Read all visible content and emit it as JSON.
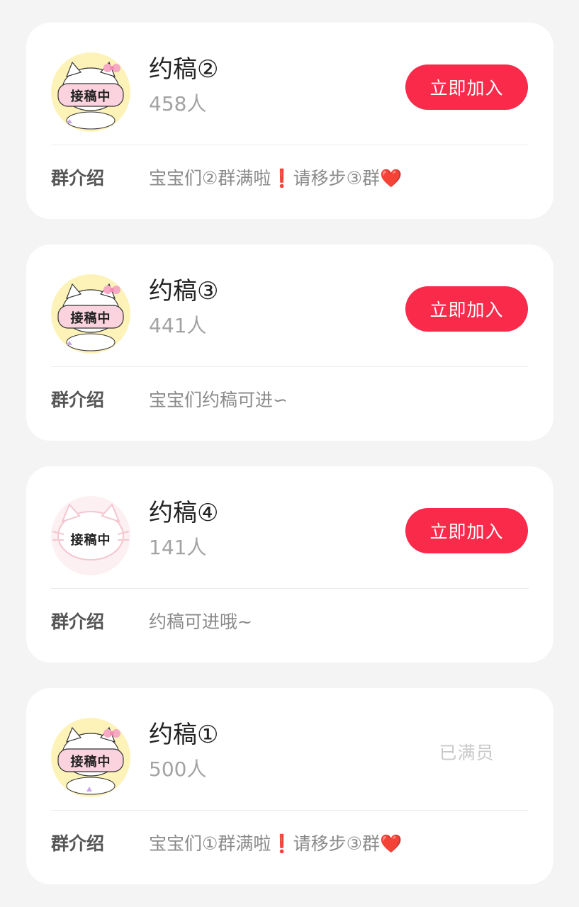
{
  "groups": [
    {
      "name": "约稿②",
      "count": "458人",
      "action_label": "立即加入",
      "intro_label": "群介绍",
      "intro_a": "宝宝们②群满啦",
      "intro_ex": "❗",
      "intro_b": "请移步③群",
      "intro_heart": "❤️",
      "avatar_text": "接稿中"
    },
    {
      "name": "约稿③",
      "count": "441人",
      "action_label": "立即加入",
      "intro_label": "群介绍",
      "intro": "宝宝们约稿可进∽",
      "avatar_text": "接稿中"
    },
    {
      "name": "约稿④",
      "count": "141人",
      "action_label": "立即加入",
      "intro_label": "群介绍",
      "intro": "约稿可进哦~",
      "avatar_text": "接稿中"
    },
    {
      "name": "约稿①",
      "count": "500人",
      "status_label": "已满员",
      "intro_label": "群介绍",
      "intro_a": "宝宝们①群满啦",
      "intro_ex": "❗",
      "intro_b": "请移步③群",
      "intro_heart": "❤️",
      "avatar_text": "接稿中"
    }
  ],
  "colors": {
    "accent": "#fa2a4a",
    "page_bg": "#f4f4f4",
    "card_bg": "#ffffff",
    "muted_text": "#a3a3a3"
  }
}
